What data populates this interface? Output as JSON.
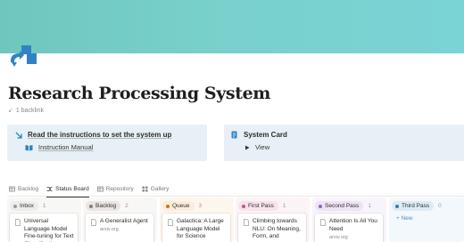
{
  "colors": {
    "cover": "#79d0cb",
    "icon": "#2f83c4",
    "callout_bg": "#e6f0f6"
  },
  "page": {
    "icon": "swap-arrows-icon",
    "title": "Research Processing System",
    "backlink": "1 backlink"
  },
  "callouts": {
    "instructions": {
      "heading": "Read the instructions to set the system up",
      "link": "Instruction Manual"
    },
    "system_card": {
      "heading": "System Card",
      "toggle": "View"
    }
  },
  "views": [
    {
      "label": "Backlog",
      "icon": "table-icon"
    },
    {
      "label": "Status Board",
      "icon": "board-icon",
      "active": true
    },
    {
      "label": "Repository",
      "icon": "table-icon"
    },
    {
      "label": "Gallery",
      "icon": "gallery-icon"
    }
  ],
  "board": {
    "columns": [
      {
        "name": "Inbox",
        "count": "1",
        "dot": "#9b9a97",
        "pill": "#ededeb",
        "bg": "#f7f7f5",
        "card": {
          "title": "Universal Language Model Fine-tuning for Text Classification",
          "source": ""
        }
      },
      {
        "name": "Backlog",
        "count": "2",
        "dot": "#8d7a6b",
        "pill": "#e9e5e3",
        "bg": "#f9f7f6",
        "card": {
          "title": "A Generalist Agent",
          "source": "arxiv.org"
        }
      },
      {
        "name": "Queue",
        "count": "3",
        "dot": "#d9730d",
        "pill": "#fbecdd",
        "bg": "#fdf6ee",
        "card": {
          "title": "Galactica: A Large Language Model for Science",
          "source": ""
        }
      },
      {
        "name": "First Pass",
        "count": "1",
        "dot": "#d44c8a",
        "pill": "#f8e2ec",
        "bg": "#fcf3f7",
        "card": {
          "title": "Climbing towards NLU: On Meaning, Form, and",
          "source": ""
        }
      },
      {
        "name": "Second Pass",
        "count": "1",
        "dot": "#9065b0",
        "pill": "#ede3f5",
        "bg": "#f8f4fb",
        "card": {
          "title": "Attention Is All You Need",
          "source": "arxiv.org"
        }
      },
      {
        "name": "Third Pass",
        "count": "0",
        "dot": "#337ea9",
        "pill": "#dcebf5",
        "bg": "#f3f8fc",
        "new_label": "+ New"
      }
    ]
  }
}
